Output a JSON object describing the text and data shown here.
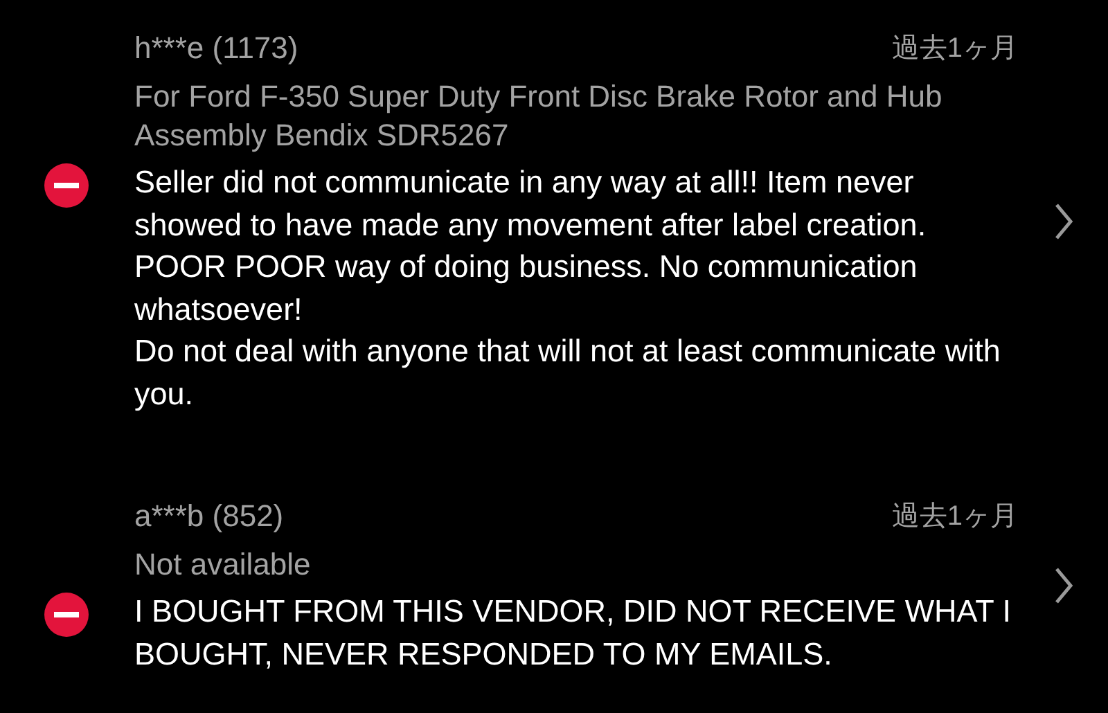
{
  "reviews": [
    {
      "user": "h***e (1173)",
      "date": "過去1ヶ月",
      "item": "For Ford F-350 Super Duty Front Disc Brake Rotor and Hub Assembly Bendix SDR5267",
      "kind": "negative",
      "comment": "Seller did not communicate in any way at all!! Item never showed to have made any movement after label creation. POOR POOR way of doing business. No communication whatsoever!\nDo not deal with anyone that will not at least communicate with you."
    },
    {
      "user": "a***b (852)",
      "date": "過去1ヶ月",
      "item": "Not available",
      "kind": "negative",
      "comment": "I BOUGHT FROM THIS VENDOR, DID NOT RECEIVE WHAT I BOUGHT, NEVER RESPONDED TO MY EMAILS."
    }
  ]
}
